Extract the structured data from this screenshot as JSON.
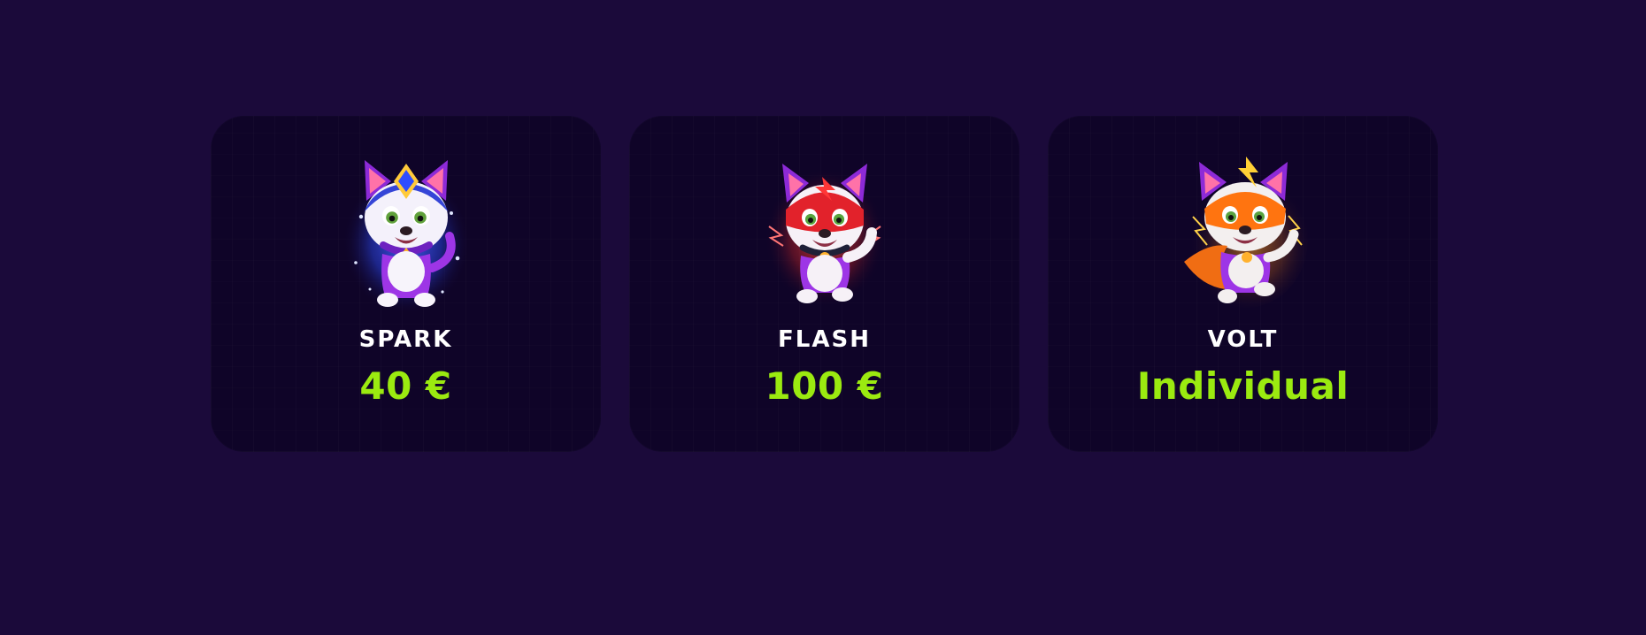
{
  "plans": [
    {
      "name": "SPARK",
      "price": "40 €",
      "mascot_icon": "blue-crown-fox-hero-icon",
      "accent": "#3e57ff"
    },
    {
      "name": "FLASH",
      "price": "100 €",
      "mascot_icon": "red-mask-fox-hero-icon",
      "accent": "#ff3b3b"
    },
    {
      "name": "VOLT",
      "price": "Individual",
      "mascot_icon": "orange-lightning-fox-hero-icon",
      "accent": "#ff7a12"
    }
  ],
  "colors": {
    "page_background": "#1b0a3a",
    "card_background": "#0f0428",
    "price_text": "#9bea10",
    "name_text": "#ffffff"
  }
}
